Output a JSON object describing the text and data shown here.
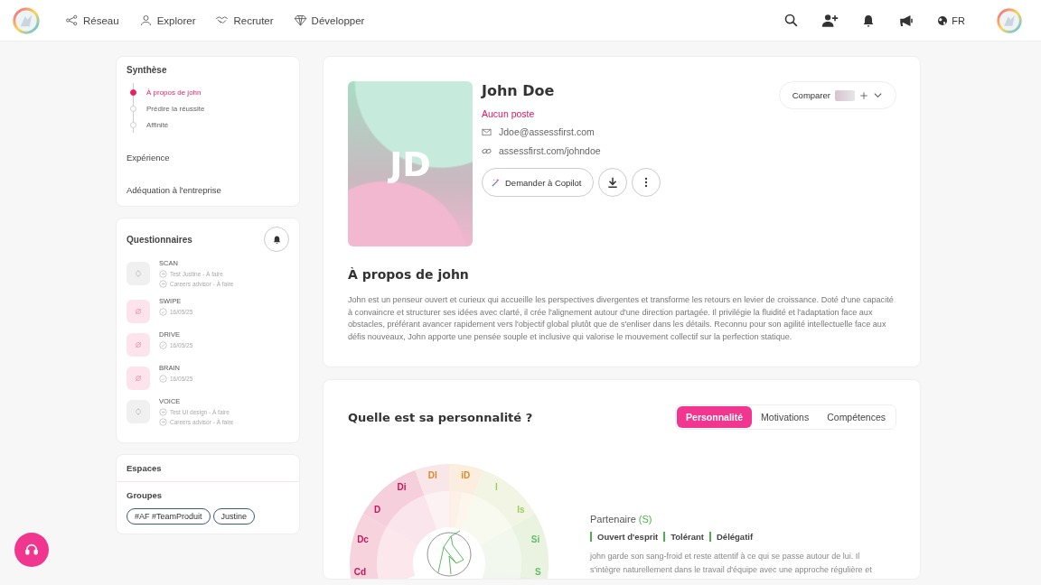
{
  "nav": {
    "links": [
      {
        "label": "Réseau",
        "selected": false
      },
      {
        "label": "Explorer",
        "selected": false
      },
      {
        "label": "Recruter",
        "selected": false
      },
      {
        "label": "Développer",
        "selected": false
      }
    ],
    "language": "FR"
  },
  "synthese": {
    "title": "Synthèse",
    "steps": [
      {
        "label": "À propos de john",
        "selected": true
      },
      {
        "label": "Prédire la réussite",
        "selected": false
      },
      {
        "label": "Affinité",
        "selected": false
      }
    ],
    "sections": [
      "Expérience",
      "Adéquation à l'entreprise"
    ]
  },
  "questionnaires": {
    "title": "Questionnaires",
    "items": [
      {
        "name": "SCAN",
        "done": false,
        "lines": [
          "Test Justine - À faire",
          "Careers advisor - À faire"
        ]
      },
      {
        "name": "SWIPE",
        "done": true,
        "lines": [
          "16/05/25"
        ]
      },
      {
        "name": "DRIVE",
        "done": true,
        "lines": [
          "16/05/25"
        ]
      },
      {
        "name": "BRAIN",
        "done": true,
        "lines": [
          "16/05/25"
        ]
      },
      {
        "name": "VOICE",
        "done": false,
        "lines": [
          "Test UI design - À faire",
          "Careers advisor - À faire"
        ]
      }
    ]
  },
  "spaces": {
    "title": "Espaces"
  },
  "groups": {
    "title": "Groupes",
    "tags": [
      "#AF #TeamProduit",
      "Justine"
    ]
  },
  "profile": {
    "initials": "JD",
    "name": "John Doe",
    "position": "Aucun poste",
    "email": "Jdoe@assessfirst.com",
    "link": "assessfirst.com/johndoe",
    "copilot_button": "Demander à Copilot",
    "compare_button": "Comparer"
  },
  "about": {
    "title": "À propos de john",
    "text": "John est un penseur ouvert et curieux qui accueille les perspectives divergentes et transforme les retours en levier de croissance. Doté d'une capacité à convaincre et structurer ses idées avec clarté, il crée l'alignement autour d'une direction partagée. Il privilégie la fluidité et l'adaptation face aux obstacles, préférant avancer rapidement vers l'objectif global plutôt que de s'enliser dans les détails. Reconnu pour son agilité intellectuelle face aux défis nouveaux, John apporte une pensée souple et inclusive qui valorise le mouvement collectif sur la perfection statique."
  },
  "personality": {
    "title": "Quelle est sa personnalité ?",
    "tabs": [
      {
        "label": "Personnalité",
        "selected": true
      },
      {
        "label": "Motivations",
        "selected": false
      },
      {
        "label": "Compétences",
        "selected": false
      }
    ],
    "wheel_labels": [
      {
        "label": "Cd",
        "color": "#c2185b"
      },
      {
        "label": "Dc",
        "color": "#c2185b"
      },
      {
        "label": "D",
        "color": "#c2185b"
      },
      {
        "label": "Di",
        "color": "#c2185b"
      },
      {
        "label": "DI",
        "color": "#d98a2b"
      },
      {
        "label": "iD",
        "color": "#d98a2b"
      },
      {
        "label": "I",
        "color": "#9ccc65"
      },
      {
        "label": "Is",
        "color": "#9ccc65"
      },
      {
        "label": "Si",
        "color": "#66bb6a"
      },
      {
        "label": "S",
        "color": "#66bb6a"
      }
    ],
    "profile_name": "Partenaire",
    "profile_code": "(S)",
    "traits": [
      "Ouvert d'esprit",
      "Tolérant",
      "Délégatif"
    ],
    "description": "john garde son sang-froid et reste attentif à ce qui se passe autour de lui. Il s'intègre naturellement dans le travail d'équipe avec une approche régulière et"
  }
}
